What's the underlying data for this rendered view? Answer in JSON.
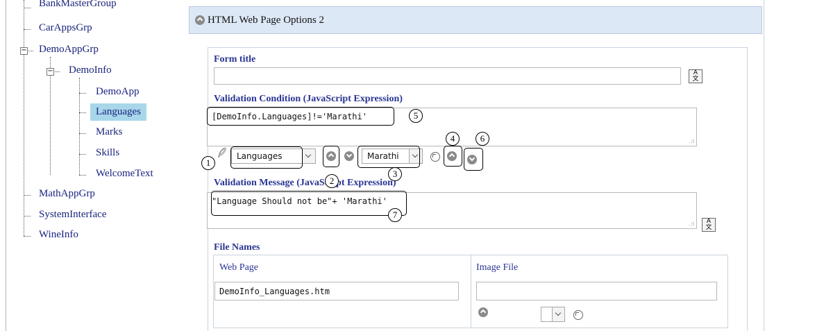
{
  "tree": {
    "items": [
      {
        "label": "BankMasterGroup"
      },
      {
        "label": "CarAppsGrp"
      },
      {
        "label": "DemoAppGrp"
      },
      {
        "label": "DemoInfo"
      },
      {
        "label": "DemoApp"
      },
      {
        "label": "Languages"
      },
      {
        "label": "Marks"
      },
      {
        "label": "Skills"
      },
      {
        "label": "WelcomeText"
      },
      {
        "label": "MathAppGrp"
      },
      {
        "label": "SystemInterface"
      },
      {
        "label": "WineInfo"
      }
    ],
    "selected": "Languages"
  },
  "panel": {
    "title": "HTML Web Page Options 2"
  },
  "form": {
    "form_title_label": "Form title",
    "form_title_value": "",
    "validation_condition_label": "Validation Condition (JavaScript Expression)",
    "validation_condition_value": "[DemoInfo.Languages]!='Marathi'",
    "field_select_value": "Languages",
    "value_select_value": "Marathi",
    "validation_message_label": "Validation Message (JavaScript Expression)",
    "validation_message_value": "\"Language Should not be\"+ 'Marathi'",
    "file_names_label": "File Names",
    "web_page_label": "Web Page",
    "web_page_value": "DemoInfo_Languages.htm",
    "image_file_label": "Image File",
    "image_file_value": ""
  },
  "callouts": [
    "1",
    "2",
    "3",
    "4",
    "5",
    "6",
    "7"
  ],
  "icons": {
    "translate": "translate-icon",
    "collapse": "collapse-circle-icon",
    "move_up": "arrow-up-circle-icon",
    "move_down": "arrow-down-circle-icon",
    "refresh": "refresh-icon",
    "field_picker": "feather-icon"
  }
}
